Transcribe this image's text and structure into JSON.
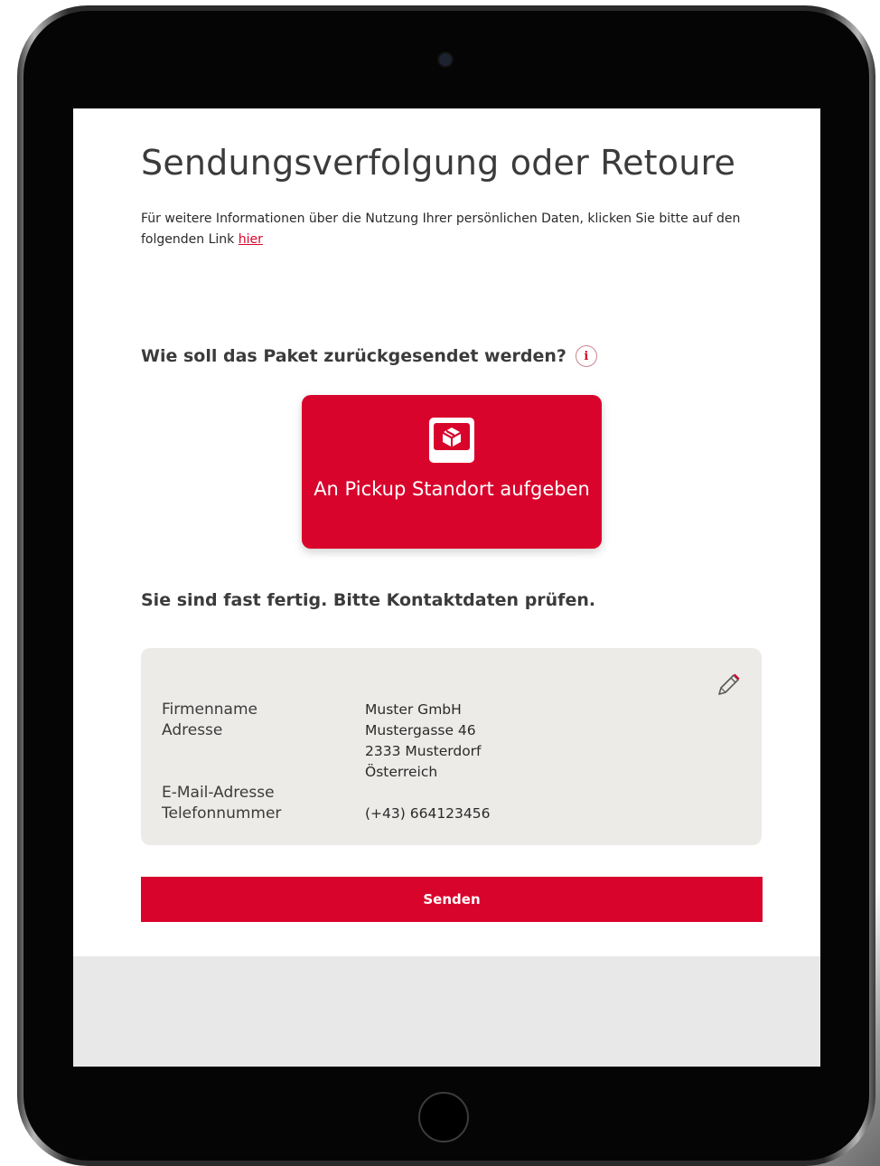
{
  "page": {
    "title": "Sendungsverfolgung oder Retoure",
    "info_text": "Für weitere Informationen über die Nutzung Ihrer persönlichen Daten, klicken Sie bitte auf den folgenden Link ",
    "info_link": "hier"
  },
  "return_section": {
    "question": "Wie soll das Paket zurückgesendet werden?",
    "info_icon_glyph": "i",
    "option_label": "An Pickup Standort aufgeben",
    "option_icon": "package-icon"
  },
  "contact": {
    "heading": "Sie sind fast fertig. Bitte Kontaktdaten prüfen.",
    "labels": {
      "company": "Firmenname",
      "address": "Adresse",
      "email": "E-Mail-Adresse",
      "phone": "Telefonnummer"
    },
    "values": {
      "company": "Muster GmbH",
      "street": "Mustergasse 46",
      "city": "2333 Musterdorf",
      "country": "Österreich",
      "email": "",
      "phone": "(+43) 664123456"
    },
    "edit_icon": "pencil-icon"
  },
  "actions": {
    "submit_label": "Senden"
  },
  "colors": {
    "brand_red": "#d9042c",
    "panel_grey": "#ecebe8",
    "footer_grey": "#e8e8e8",
    "text_dark": "#3b3b3b"
  }
}
